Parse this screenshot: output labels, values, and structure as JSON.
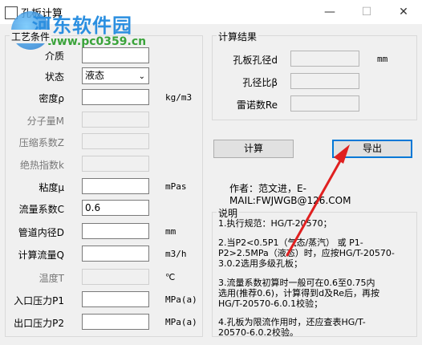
{
  "window": {
    "title": "孔板计算",
    "buttons": {
      "minimize": "—",
      "maximize": "☐",
      "close": "✕"
    }
  },
  "watermark": {
    "text": "河东软件园",
    "url": "www.pc0359.cn"
  },
  "conditions": {
    "group_title": "工艺条件",
    "medium": {
      "label": "介质",
      "value": ""
    },
    "state": {
      "label": "状态",
      "value": "液态"
    },
    "density": {
      "label": "密度ρ",
      "value": "",
      "unit": "kg/m3"
    },
    "molecular_weight": {
      "label": "分子量M",
      "value": ""
    },
    "compressibility": {
      "label": "压缩系数Z",
      "value": ""
    },
    "adiabatic_index": {
      "label": "绝热指数k",
      "value": ""
    },
    "viscosity": {
      "label": "粘度μ",
      "value": "",
      "unit": "mPas"
    },
    "flow_coefficient": {
      "label": "流量系数C",
      "value": "0.6"
    },
    "pipe_diameter": {
      "label": "管道内径D",
      "value": "",
      "unit": "mm"
    },
    "flow_rate": {
      "label": "计算流量Q",
      "value": "",
      "unit": "m3/h"
    },
    "temperature": {
      "label": "温度T",
      "value": "",
      "unit": "℃"
    },
    "inlet_pressure": {
      "label": "入口压力P1",
      "value": "",
      "unit": "MPa(a)"
    },
    "outlet_pressure": {
      "label": "出口压力P2",
      "value": "",
      "unit": "MPa(a)"
    }
  },
  "results": {
    "group_title": "计算结果",
    "orifice_diameter": {
      "label": "孔板孔径d",
      "unit": "mm"
    },
    "diameter_ratio": {
      "label": "孔径比β"
    },
    "reynolds": {
      "label": "雷诺数Re"
    }
  },
  "actions": {
    "calculate": "计算",
    "export": "导出"
  },
  "author": "作者：范文进，E-MAIL:FWJWGB@126.COM",
  "notes": {
    "title": "说明",
    "lines": [
      "1.执行规范：HG/T-20570；",
      "2.当P2<0.5P1（气态/蒸汽） 或  P1-",
      "P2>2.5MPa（液态）时，应按HG/T-20570-",
      "3.0.2选用多级孔板；",
      "3.流量系数初算时一般可在0.6至0.75内",
      "选用(推荐0.6)，计算得到d及Re后，再按",
      "HG/T-20570-6.0.1校验；",
      "4.孔板为限流作用时，还应查表HG/T-",
      "20570-6.0.2校验。"
    ]
  },
  "colors": {
    "annotation_arrow": "#e02020",
    "focus_border": "#0078d7"
  }
}
